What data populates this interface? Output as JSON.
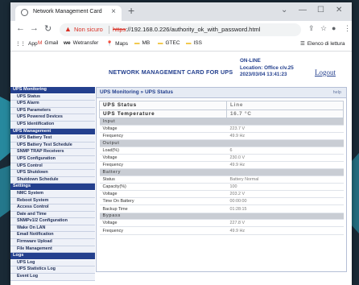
{
  "browser": {
    "tab_title": "Network Management Card",
    "tab_close": "×",
    "new_tab": "+",
    "controls": {
      "chevron": "⌄",
      "minimize": "—",
      "maximize": "☐",
      "close": "✕"
    },
    "nav": {
      "back": "←",
      "forward": "→",
      "reload": "↻"
    },
    "security_text": "Non sicuro",
    "url_strike": "https",
    "url_rest": "://192.168.0.226/authority_ok_with_password.html",
    "bookmarks": [
      {
        "icon": "⋮⋮",
        "label": "App"
      },
      {
        "icon": "M",
        "label": "Gmail"
      },
      {
        "icon": "we",
        "label": "Wetransfer"
      },
      {
        "icon": "📍",
        "label": "Maps"
      },
      {
        "icon": "▬",
        "label": "MB"
      },
      {
        "icon": "▬",
        "label": "GTEC"
      },
      {
        "icon": "▬",
        "label": "ISS"
      }
    ],
    "reading_list": "Elenco di lettura"
  },
  "header": {
    "title": "NETWORK MANAGEMENT CARD FOR UPS",
    "status": "ON-LINE",
    "location": "Location: Office clv.25",
    "datetime": "2023/03/04 13:41:23",
    "logout": "Logout"
  },
  "sidebar": [
    {
      "type": "head",
      "label": "UPS Monitoring"
    },
    {
      "type": "item",
      "label": "UPS Status"
    },
    {
      "type": "item",
      "label": "UPS Alarm"
    },
    {
      "type": "item",
      "label": "UPS Parameters"
    },
    {
      "type": "item",
      "label": "UPS Powered Devices"
    },
    {
      "type": "item",
      "label": "UPS Identification"
    },
    {
      "type": "head",
      "label": "UPS Management"
    },
    {
      "type": "item",
      "label": "UPS Battery Test"
    },
    {
      "type": "item",
      "label": "UPS Battery Test Schedule"
    },
    {
      "type": "item",
      "label": "SNMP TRAP Receivers"
    },
    {
      "type": "item",
      "label": "UPS Configuration"
    },
    {
      "type": "item",
      "label": "UPS Control"
    },
    {
      "type": "item",
      "label": "UPS Shutdown"
    },
    {
      "type": "item",
      "label": "Shutdown Schedule"
    },
    {
      "type": "head",
      "label": "Settings"
    },
    {
      "type": "item",
      "label": "NMC System"
    },
    {
      "type": "item",
      "label": "Reboot System"
    },
    {
      "type": "item",
      "label": "Access Control"
    },
    {
      "type": "item",
      "label": "Date and Time"
    },
    {
      "type": "item",
      "label": "SNMPv1/2 Configuration"
    },
    {
      "type": "item",
      "label": "Wake On LAN"
    },
    {
      "type": "item",
      "label": "Email Notification"
    },
    {
      "type": "item",
      "label": "Firmware Upload"
    },
    {
      "type": "item",
      "label": "File Management"
    },
    {
      "type": "head",
      "label": "Logs"
    },
    {
      "type": "item",
      "label": "UPS Log"
    },
    {
      "type": "item",
      "label": "UPS Statistics Log"
    },
    {
      "type": "item",
      "label": "Event Log"
    }
  ],
  "main": {
    "breadcrumb": "UPS Monitoring » UPS Status",
    "help": "help",
    "rows": [
      {
        "type": "big",
        "label": "UPS Status",
        "value": "Line"
      },
      {
        "type": "big",
        "label": "UPS Temperature",
        "value": "16.7 °C"
      },
      {
        "type": "section",
        "label": "Input"
      },
      {
        "type": "row",
        "label": "Voltage",
        "value": "223.7 V"
      },
      {
        "type": "row",
        "label": "Frequency",
        "value": "49.9 Hz"
      },
      {
        "type": "section",
        "label": "Output"
      },
      {
        "type": "row",
        "label": "Load(%)",
        "value": "6"
      },
      {
        "type": "row",
        "label": "Voltage",
        "value": "230.0 V"
      },
      {
        "type": "row",
        "label": "Frequency",
        "value": "49.9 Hz"
      },
      {
        "type": "section",
        "label": "Battery"
      },
      {
        "type": "row",
        "label": "Status",
        "value": "Battery Normal"
      },
      {
        "type": "row",
        "label": "Capacity(%)",
        "value": "100"
      },
      {
        "type": "row",
        "label": "Voltage",
        "value": "203.2 V"
      },
      {
        "type": "row",
        "label": "Time On Battery",
        "value": "00:00:00"
      },
      {
        "type": "row",
        "label": "Backup Time",
        "value": "01:28:15"
      },
      {
        "type": "section",
        "label": "Bypass"
      },
      {
        "type": "row",
        "label": "Voltage",
        "value": "227.8 V"
      },
      {
        "type": "row",
        "label": "Frequency",
        "value": "49.9 Hz"
      }
    ]
  }
}
